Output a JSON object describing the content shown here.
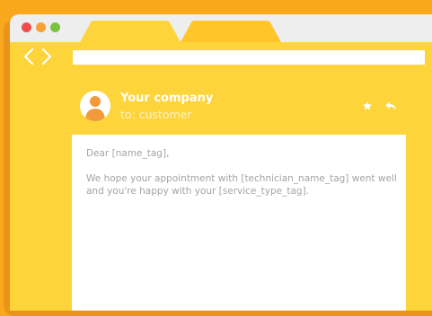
{
  "window": {
    "controls": [
      "close",
      "minimize",
      "maximize"
    ],
    "tabs": [
      "tab-1",
      "tab-2"
    ],
    "address_value": ""
  },
  "nav": {
    "back_icon": "chevron-left-icon",
    "forward_icon": "chevron-right-icon"
  },
  "email": {
    "sender": "Your company",
    "recipient": "to: customer",
    "action_icons": [
      "star-icon",
      "reply-icon"
    ],
    "greeting": "Dear [name_tag],",
    "message": "We hope your appointment with [technician_name_tag] went well and you're happy with your [service_type_tag]."
  },
  "colors": {
    "background": "#f9a81b",
    "window": "#fdd43a",
    "active_tab": "#ffc52a",
    "avatar_head": "#f39a3a"
  }
}
